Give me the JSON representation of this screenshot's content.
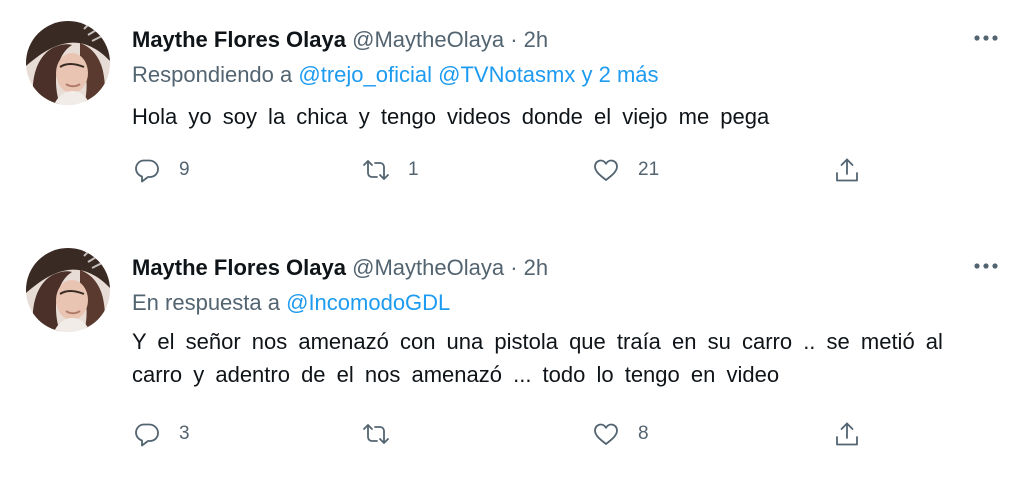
{
  "tweets": [
    {
      "author_name": "Maythe Flores Olaya",
      "handle": "@MaytheOlaya",
      "separator": "·",
      "time": "2h",
      "reply_prefix": "Respondiendo a",
      "mentions": [
        "@trejo_oficial",
        "@TVNotasmx",
        "y 2 más"
      ],
      "text": "Hola yo soy la chica y tengo videos donde el viejo me pega",
      "reply_count": "9",
      "retweet_count": "1",
      "like_count": "21"
    },
    {
      "author_name": "Maythe Flores Olaya",
      "handle": "@MaytheOlaya",
      "separator": "·",
      "time": "2h",
      "reply_prefix": "En respuesta a",
      "mentions": [
        "@IncomodoGDL"
      ],
      "text": "Y el señor nos amenazó con una pistola que traía en su carro .. se metió al carro y adentro de el nos amenazó ... todo lo tengo en video",
      "reply_count": "3",
      "retweet_count": "",
      "like_count": "8"
    }
  ],
  "icons": {
    "more": "more-icon",
    "reply": "reply-icon",
    "retweet": "retweet-icon",
    "like": "heart-icon",
    "share": "share-icon"
  },
  "colors": {
    "text": "#0f1419",
    "secondary": "#536471",
    "link": "#1d9bf0",
    "background": "#ffffff"
  }
}
